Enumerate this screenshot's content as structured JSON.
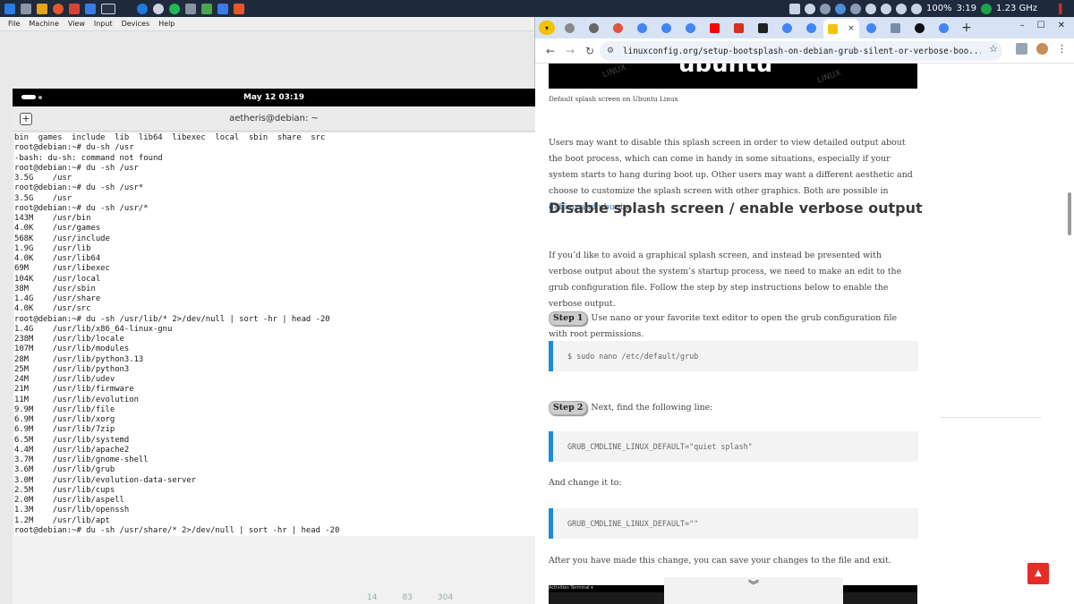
{
  "taskbar": {
    "tray": {
      "battery": "100%",
      "time": "3:19",
      "cpu": "1.23 GHz"
    }
  },
  "vm": {
    "menu": [
      "File",
      "Machine",
      "View",
      "Input",
      "Devices",
      "Help"
    ],
    "gnome": {
      "clock": "May 12  03:19"
    },
    "terminal": {
      "title": "aetheris@debian: ~",
      "lines": [
        "bin  games  include  lib  lib64  libexec  local  sbin  share  src",
        "root@debian:~# du-sh /usr",
        "-bash: du-sh: command not found",
        "root@debian:~# du -sh /usr",
        "3.5G    /usr",
        "root@debian:~# du -sh /usr*",
        "3.5G    /usr",
        "root@debian:~# du -sh /usr/*",
        "143M    /usr/bin",
        "4.0K    /usr/games",
        "568K    /usr/include",
        "1.9G    /usr/lib",
        "4.0K    /usr/lib64",
        "69M     /usr/libexec",
        "104K    /usr/local",
        "38M     /usr/sbin",
        "1.4G    /usr/share",
        "4.0K    /usr/src",
        "root@debian:~# du -sh /usr/lib/* 2>/dev/null | sort -hr | head -20",
        "1.4G    /usr/lib/x86_64-linux-gnu",
        "238M    /usr/lib/locale",
        "107M    /usr/lib/modules",
        "28M     /usr/lib/python3.13",
        "25M     /usr/lib/python3",
        "24M     /usr/lib/udev",
        "21M     /usr/lib/firmware",
        "11M     /usr/lib/evolution",
        "9.9M    /usr/lib/file",
        "6.9M    /usr/lib/xorg",
        "6.9M    /usr/lib/7zip",
        "6.5M    /usr/lib/systemd",
        "4.4M    /usr/lib/apache2",
        "3.7M    /usr/lib/gnome-shell",
        "3.6M    /usr/lib/grub",
        "3.0M    /usr/lib/evolution-data-server",
        "2.5M    /usr/lib/cups",
        "2.0M    /usr/lib/aspell",
        "1.3M    /usr/lib/openssh",
        "1.2M    /usr/lib/apt",
        "root@debian:~# du -sh /usr/share/* 2>/dev/null | sort -hr | head -20"
      ]
    },
    "under_stats": [
      "14",
      "83",
      "304"
    ]
  },
  "browser": {
    "url": "linuxconfig.org/setup-bootsplash-on-debian-grub-silent-or-verbose-boo...",
    "tab_close": "×",
    "new_tab": "+",
    "window_controls": [
      "–",
      "☐",
      "✕"
    ],
    "article": {
      "hero_word": "ubuntu",
      "hero_watermark": "LINUX",
      "caption": "Default splash screen on Ubuntu Linux",
      "para1_text": "Users may want to disable this splash screen in order to view detailed output about the boot process, which can come in handy in some situations, especially if your system starts to hang during boot up. Other users may want a different aesthetic and choose to customize the splash screen with other graphics. Both are possible in ",
      "para1_link": "debian and ubuntu",
      "para1_end": ".",
      "heading": "Disable splash screen / enable verbose output",
      "para2": "If you’d like to avoid a graphical splash screen, and instead be presented with verbose output about the system’s startup process, we need to make an edit to the grub configuration file. Follow the step by step instructions below to enable the verbose output.",
      "step1_badge": "Step 1",
      "step1_text": "Use nano or your favorite text editor to open the grub configuration file with root permissions.",
      "code1": "$ sudo nano /etc/default/grub",
      "step2_badge": "Step 2",
      "step2_text": "Next, find the following line:",
      "code2": "GRUB_CMDLINE_LINUX_DEFAULT=\"quiet splash\"",
      "change_text": "And change it to:",
      "code3": "GRUB_CMDLINE_LINUX_DEFAULT=\"\"",
      "after_text": "After you have made this change, you can save your changes to the file and exit.",
      "bottom_shot_bar": "Activities   Terminal ▾"
    }
  },
  "colors": {
    "taskbar": "#1f2a3d",
    "tabstrip": "#d7e3f4",
    "omnibox": "#edf2fa",
    "code_accent": "#1b8ae0",
    "link": "#2e7cbd",
    "to_top": "#e52d27"
  }
}
